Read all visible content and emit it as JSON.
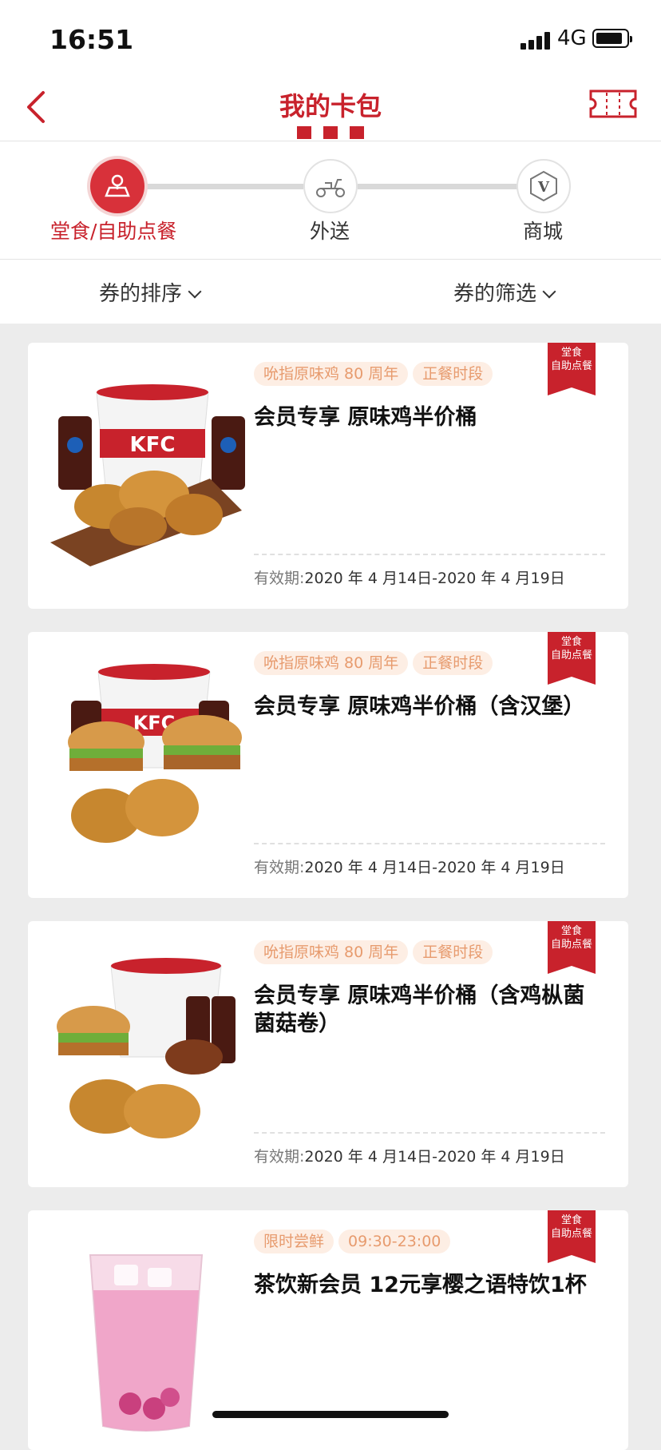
{
  "status": {
    "time": "16:51",
    "network": "4G"
  },
  "nav": {
    "title": "我的卡包"
  },
  "modes": [
    {
      "label": "堂食/自助点餐",
      "icon": "store-icon",
      "active": true
    },
    {
      "label": "外送",
      "icon": "scooter-icon",
      "active": false
    },
    {
      "label": "商城",
      "icon": "v-mall-icon",
      "active": false
    }
  ],
  "sort": {
    "sort_label": "券的排序",
    "filter_label": "券的筛选"
  },
  "colors": {
    "brand_red": "#c8222c",
    "tag_bg": "#fdeee4",
    "tag_text": "#e79b6e"
  },
  "coupons": [
    {
      "tags": [
        "吮指原味鸡 80 周年",
        "正餐时段"
      ],
      "title": "会员专享 原味鸡半价桶",
      "validity_label": "有效期:",
      "validity": "2020 年 4 月14日-2020 年 4 月19日",
      "ribbon_line1": "堂食",
      "ribbon_line2": "自助点餐",
      "image": "chicken-bucket-pepsi-image"
    },
    {
      "tags": [
        "吮指原味鸡 80 周年",
        "正餐时段"
      ],
      "title": "会员专享 原味鸡半价桶（含汉堡）",
      "validity_label": "有效期:",
      "validity": "2020 年 4 月14日-2020 年 4 月19日",
      "ribbon_line1": "堂食",
      "ribbon_line2": "自助点餐",
      "image": "chicken-bucket-burgers-image"
    },
    {
      "tags": [
        "吮指原味鸡 80 周年",
        "正餐时段"
      ],
      "title": "会员专享 原味鸡半价桶（含鸡枞菌菌菇卷）",
      "validity_label": "有效期:",
      "validity": "2020 年 4 月14日-2020 年 4 月19日",
      "ribbon_line1": "堂食",
      "ribbon_line2": "自助点餐",
      "image": "chicken-bucket-wrap-image"
    },
    {
      "tags": [
        "限时尝鲜",
        "09:30-23:00"
      ],
      "title": "茶饮新会员 12元享樱之语特饮1杯",
      "validity_label": "有效期:",
      "validity": "",
      "ribbon_line1": "堂食",
      "ribbon_line2": "自助点餐",
      "image": "sakura-drink-image"
    }
  ]
}
